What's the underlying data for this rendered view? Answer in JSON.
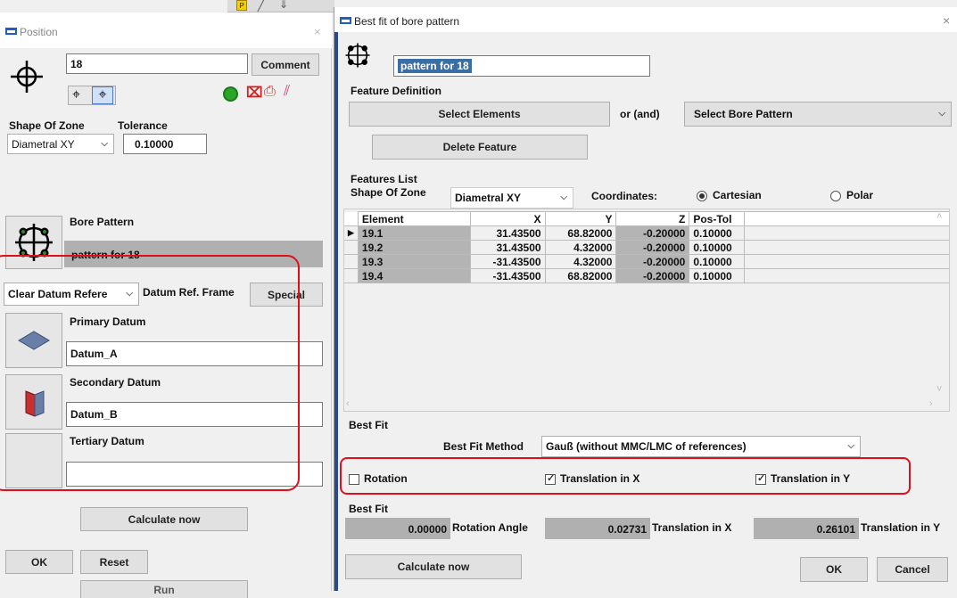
{
  "toolbar_top": {
    "icons": [
      "p-icon",
      "pencil-icon",
      "arrow-down-icon"
    ]
  },
  "position": {
    "title": "Position",
    "name_value": "18",
    "comment_label": "Comment",
    "shape_label": "Shape Of Zone",
    "tolerance_label": "Tolerance",
    "shape_value": "Diametral XY",
    "tolerance_value": "0.10000",
    "bore_pattern_label": "Bore Pattern",
    "bore_pattern_value": "pattern for 18",
    "clear_datum_value": "Clear Datum Refere",
    "datum_ref_frame_label": "Datum Ref. Frame",
    "special_label": "Special",
    "primary_label": "Primary Datum",
    "primary_value": "Datum_A",
    "secondary_label": "Secondary Datum",
    "secondary_value": "Datum_B",
    "tertiary_label": "Tertiary Datum",
    "tertiary_value": "",
    "calculate_label": "Calculate now",
    "ok_label": "OK",
    "reset_label": "Reset",
    "bottom_partial": "Run"
  },
  "bestfit": {
    "title": "Best fit of bore pattern",
    "name_value": "pattern for 18",
    "feature_definition_label": "Feature Definition",
    "select_elements_label": "Select Elements",
    "or_and_label": "or (and)",
    "select_bore_pattern_label": "Select Bore Pattern",
    "delete_feature_label": "Delete Feature",
    "features_list_label": "Features List",
    "shape_label": "Shape Of Zone",
    "shape_value": "Diametral XY",
    "coordinates_label": "Coordinates:",
    "cartesian_label": "Cartesian",
    "polar_label": "Polar",
    "columns": [
      "Element",
      "X",
      "Y",
      "Z",
      "Pos-Tol"
    ],
    "rows": [
      [
        "19.1",
        "31.43500",
        "68.82000",
        "-0.20000",
        "0.10000"
      ],
      [
        "19.2",
        "31.43500",
        "4.32000",
        "-0.20000",
        "0.10000"
      ],
      [
        "19.3",
        "-31.43500",
        "4.32000",
        "-0.20000",
        "0.10000"
      ],
      [
        "19.4",
        "-31.43500",
        "68.82000",
        "-0.20000",
        "0.10000"
      ]
    ],
    "bestfit_group1_label": "Best Fit",
    "method_label": "Best Fit Method",
    "method_value": "Gauß  (without MMC/LMC of references)",
    "rotation_label": "Rotation",
    "translation_x_label": "Translation in X",
    "translation_y_label": "Translation in Y",
    "bestfit_group2_label": "Best Fit",
    "rotation_angle_value": "0.00000",
    "rotation_angle_label": "Rotation Angle",
    "trans_x_value": "0.02731",
    "trans_x_label": "Translation in X",
    "trans_y_value": "0.26101",
    "trans_y_label": "Translation in Y",
    "calculate_label": "Calculate now",
    "ok_label": "OK",
    "cancel_label": "Cancel"
  }
}
